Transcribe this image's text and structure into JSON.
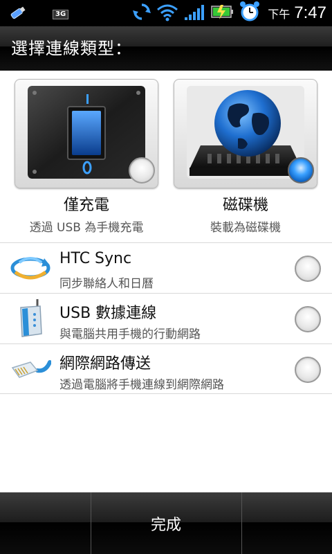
{
  "status_bar": {
    "network_badge": "3G",
    "ampm": "下午",
    "time": "7:47",
    "icons": [
      "usb-icon",
      "network-3g-icon",
      "sync-icon",
      "wifi-icon",
      "signal-icon",
      "battery-charging-icon",
      "alarm-clock-icon"
    ]
  },
  "dialog": {
    "title": "選擇連線類型：",
    "options": [
      {
        "title": "僅充電",
        "subtitle": "透過 USB 為手機充電",
        "selected": false,
        "icon": "charge-switch-icon"
      },
      {
        "title": "磁碟機",
        "subtitle": "裝載為磁碟機",
        "selected": true,
        "icon": "disk-drive-globe-icon"
      }
    ],
    "list": [
      {
        "title": "HTC Sync",
        "subtitle": "同步聯絡人和日曆",
        "selected": false,
        "icon": "htc-sync-icon"
      },
      {
        "title": "USB 數據連線",
        "subtitle": "與電腦共用手機的行動網路",
        "selected": false,
        "icon": "router-icon"
      },
      {
        "title": "網際網路傳送",
        "subtitle": "透過電腦將手機連線到網際網路",
        "selected": false,
        "icon": "ethernet-cable-icon"
      }
    ],
    "done_label": "完成"
  },
  "colors": {
    "accent": "#1a7ad8",
    "title_bg": "#1f1f1f",
    "text": "#111111",
    "subtext": "#555555"
  }
}
